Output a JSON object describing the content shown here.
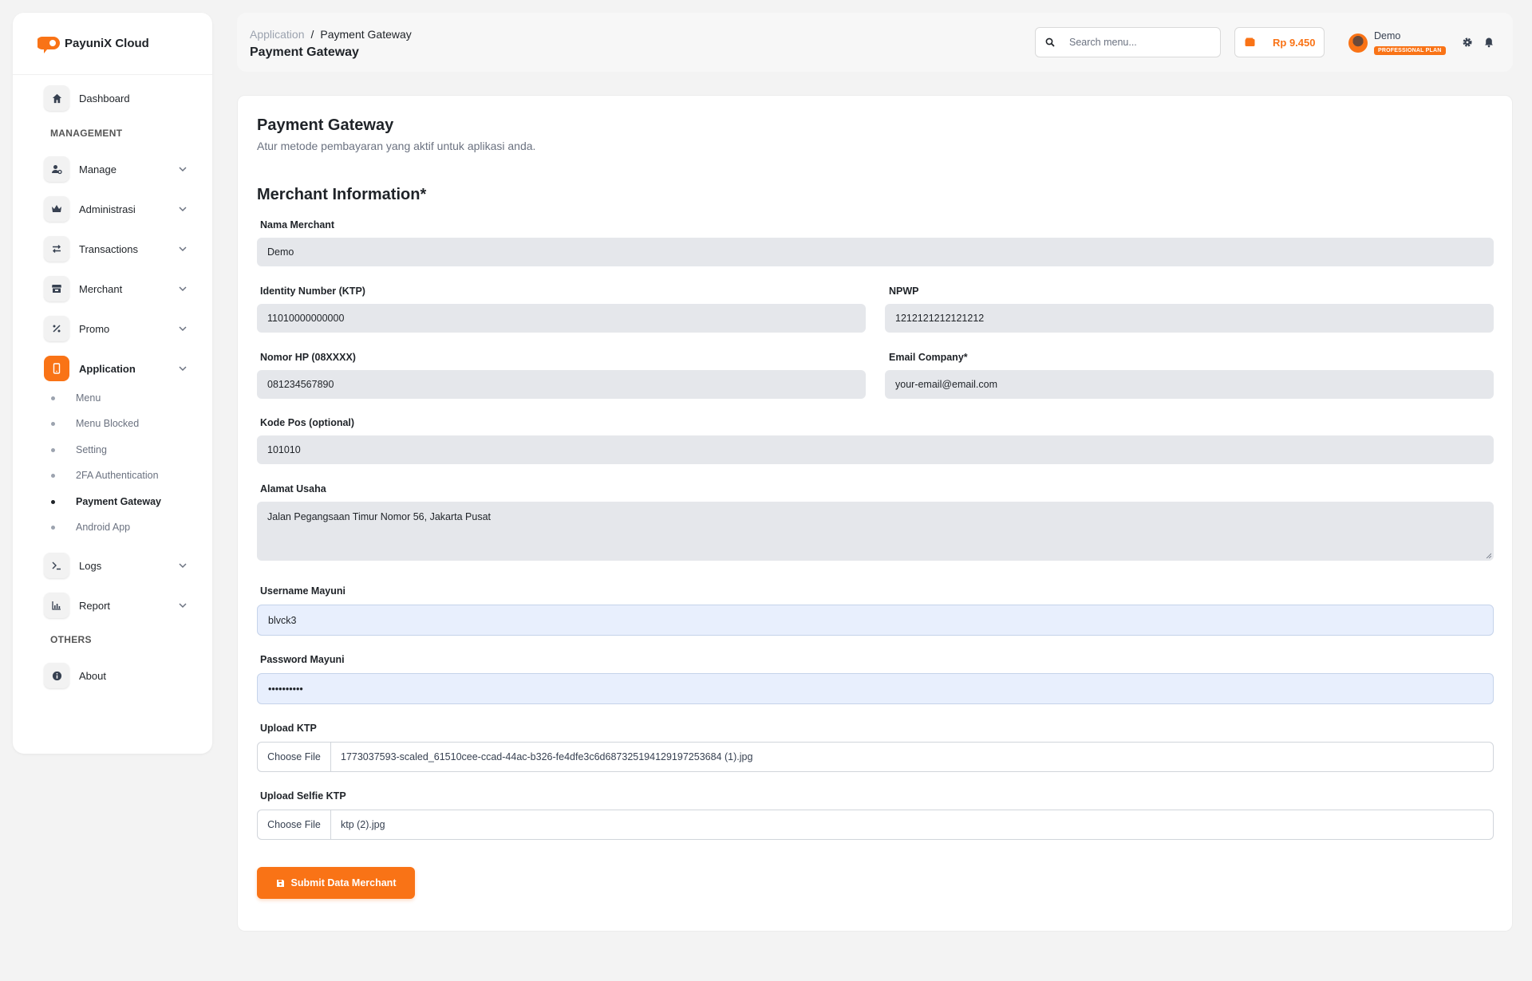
{
  "brand": {
    "name": "PayuniX Cloud"
  },
  "sidebar": {
    "dashboard": "Dashboard",
    "section_management": "MANAGEMENT",
    "items": [
      {
        "label": "Manage",
        "icon": "user-gear-icon"
      },
      {
        "label": "Administrasi",
        "icon": "crown-icon"
      },
      {
        "label": "Transactions",
        "icon": "arrows-exchange-icon"
      },
      {
        "label": "Merchant",
        "icon": "store-icon"
      },
      {
        "label": "Promo",
        "icon": "percent-icon"
      },
      {
        "label": "Application",
        "icon": "mobile-icon"
      }
    ],
    "sub_items": [
      "Menu",
      "Menu Blocked",
      "Setting",
      "2FA Authentication",
      "Payment Gateway",
      "Android App"
    ],
    "items_after": [
      {
        "label": "Logs",
        "icon": "terminal-icon"
      },
      {
        "label": "Report",
        "icon": "chart-icon"
      }
    ],
    "section_others": "OTHERS",
    "about": "About"
  },
  "header": {
    "breadcrumb_parent": "Application",
    "breadcrumb_sep": "/",
    "breadcrumb_current": "Payment Gateway",
    "title": "Payment Gateway",
    "search_placeholder": "Search menu...",
    "balance": "Rp 9.450",
    "user_name": "Demo",
    "plan": "PROFESSIONAL PLAN"
  },
  "main": {
    "title": "Payment Gateway",
    "subtitle": "Atur metode pembayaran yang aktif untuk aplikasi anda.",
    "section_title": "Merchant Information*",
    "fields": {
      "nama_merchant": {
        "label": "Nama Merchant",
        "value": "Demo"
      },
      "ktp": {
        "label": "Identity Number (KTP)",
        "value": "11010000000000"
      },
      "npwp": {
        "label": "NPWP",
        "value": "1212121212121212"
      },
      "hp": {
        "label": "Nomor HP (08XXXX)",
        "value": "081234567890"
      },
      "email": {
        "label": "Email Company*",
        "value": "your-email@email.com"
      },
      "kodepos": {
        "label": "Kode Pos (optional)",
        "value": "101010"
      },
      "alamat": {
        "label": "Alamat Usaha",
        "value": "Jalan Pegangsaan Timur Nomor 56, Jakarta Pusat"
      },
      "username": {
        "label": "Username Mayuni",
        "value": "blvck3"
      },
      "password": {
        "label": "Password Mayuni",
        "value": "••••••••••"
      },
      "upload_ktp": {
        "label": "Upload KTP",
        "button": "Choose File",
        "file": "1773037593-scaled_61510cee-ccad-44ac-b326-fe4dfe3c6d687325194129197253684 (1).jpg"
      },
      "upload_selfie": {
        "label": "Upload Selfie KTP",
        "button": "Choose File",
        "file": "ktp (2).jpg"
      }
    },
    "submit": "Submit Data Merchant"
  },
  "colors": {
    "accent": "#f97316",
    "page_bg": "#f3f3f3",
    "field_bg": "#e5e7eb",
    "field_blue": "#e8effd"
  }
}
